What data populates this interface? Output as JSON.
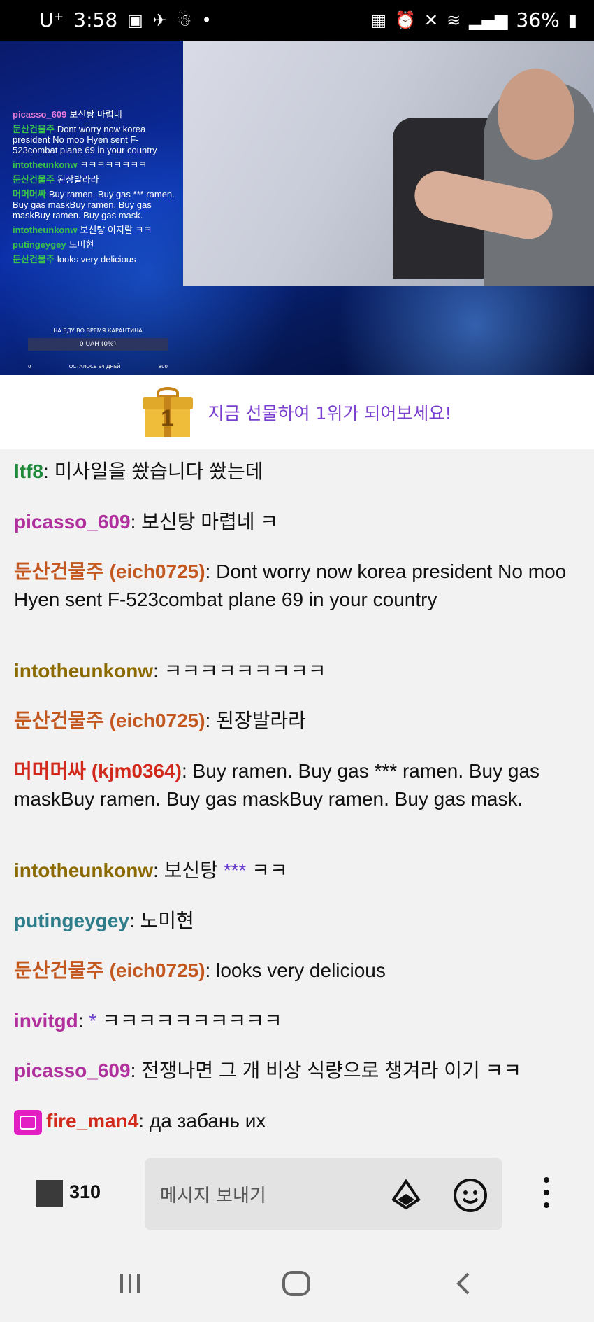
{
  "status_bar": {
    "carrier": "U⁺",
    "time": "3:58",
    "left_icons": [
      "image-icon",
      "plane-icon",
      "figure-icon",
      "dot-icon"
    ],
    "right_icons": [
      "battery-saver-icon",
      "alarm-icon",
      "mute-icon",
      "wifi-icon",
      "signal-icon"
    ],
    "battery": "36%"
  },
  "video": {
    "overlay_chat": [
      {
        "user": "picasso_609",
        "text": "보신탕 마렵네",
        "color": "#e07ad6"
      },
      {
        "user": "둔산건물주",
        "text": "Dont worry now korea president No moo Hyen sent F-523combat plane 69 in your country",
        "color": "#39c24a"
      },
      {
        "user": "intotheunkonw",
        "text": "ㅋㅋㅋㅋㅋㅋㅋㅋ",
        "color": "#39c24a"
      },
      {
        "user": "둔산건물주",
        "text": "된장발라라",
        "color": "#39c24a"
      },
      {
        "user": "머머머싸",
        "text": "Buy ramen. Buy gas *** ramen. Buy gas maskBuy ramen. Buy gas maskBuy ramen. Buy gas mask.",
        "color": "#39c24a"
      },
      {
        "user": "intotheunkonw",
        "text": "보신탕 이지랄 ㅋㅋ",
        "color": "#39c24a"
      },
      {
        "user": "putingeygey",
        "text": "노미현",
        "color": "#39c24a"
      },
      {
        "user": "둔산건물주",
        "text": "looks very delicious",
        "color": "#39c24a"
      }
    ],
    "donation_title": "НА ЕДУ ВО ВРЕМЯ КАРАНТИНА",
    "donation_bar": "0 UAH (0%)",
    "donation_min": "0",
    "donation_left": "ОСТАЛОСЬ 94 ДНЕЙ",
    "donation_max": "800"
  },
  "gift_banner": {
    "rank": "1",
    "text": "지금 선물하여 1위가 되어보세요!"
  },
  "chat": [
    {
      "user": "ltf8",
      "color": "#1f8a3a",
      "text": "미사일을 쐈습니다 쐈는데"
    },
    {
      "user": "picasso_609",
      "color": "#b0309e",
      "text": "보신탕 마렵네 ㅋ"
    },
    {
      "user": "둔산건물주 (eich0725)",
      "color": "#c2571f",
      "text": "Dont worry now korea president No moo Hyen sent F-523combat plane 69 in your country"
    },
    {
      "user": "intotheunkonw",
      "color": "#8c6a00",
      "text": "ㅋㅋㅋㅋㅋㅋㅋㅋㅋ"
    },
    {
      "user": "둔산건물주 (eich0725)",
      "color": "#c2571f",
      "text": "된장발라라"
    },
    {
      "user": "머머머싸 (kjm0364)",
      "color": "#d12a1c",
      "text": "Buy ramen. Buy gas *** ramen. Buy gas maskBuy ramen. Buy gas maskBuy ramen. Buy gas mask."
    },
    {
      "user": "intotheunkonw",
      "color": "#8c6a00",
      "text_before": "보신탕 ",
      "mention": "***",
      "text_after": " ㅋㅋ"
    },
    {
      "user": "putingeygey",
      "color": "#2e7d8a",
      "text": "노미현"
    },
    {
      "user": "둔산건물주 (eich0725)",
      "color": "#c2571f",
      "text": "looks very delicious"
    },
    {
      "user": "invitgd",
      "color": "#b0309e",
      "text_before": "",
      "mention": "*",
      "text_after": " ㅋㅋㅋㅋㅋㅋㅋㅋㅋㅋ"
    },
    {
      "user": "picasso_609",
      "color": "#b0309e",
      "text": "전쟁나면 그 개 비상 식량으로 챙겨라 이기 ㅋㅋ"
    },
    {
      "user": "fire_man4",
      "color": "#d12a1c",
      "text": "да забань их",
      "badge": "gem-badge-icon"
    }
  ],
  "input_bar": {
    "viewer_count": "310",
    "placeholder": "메시지 보내기",
    "icons": [
      "bits-icon",
      "emoji-icon",
      "more-icon"
    ]
  },
  "nav_bar": {
    "icons": [
      "recent-apps-icon",
      "home-icon",
      "back-icon"
    ]
  }
}
